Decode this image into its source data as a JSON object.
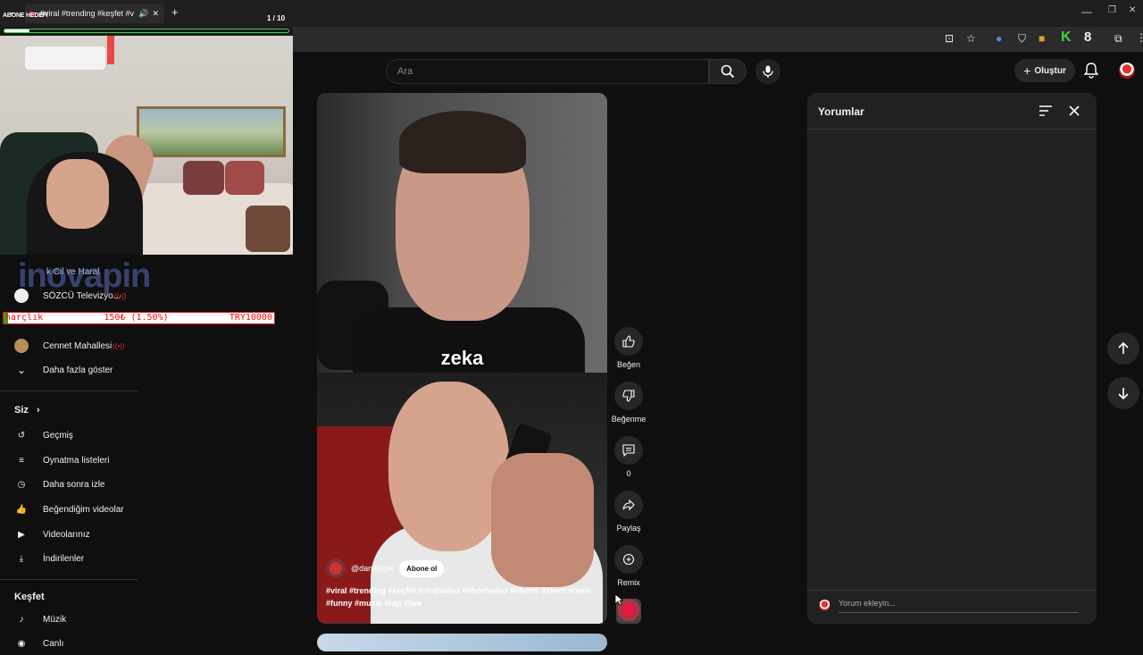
{
  "browser": {
    "tab_title": "#viral #trending #keşfet #v",
    "new_tab": "+",
    "minimize": "—",
    "restore": "❐",
    "close": "✕",
    "ext_badge": "8"
  },
  "header": {
    "search_placeholder": "Ara",
    "create_label": "Oluştur"
  },
  "overlay": {
    "goal_label": "ABONE HEDEFİ",
    "goal_count": "1 / 10",
    "tip_label": "harçlık",
    "tip_amount": "150₺ (1.50%)",
    "tip_target": "TRY10000",
    "tip_progress": 0.015,
    "sponsor": "inovapin"
  },
  "sidebar": {
    "subs": [
      {
        "label": "Cennet Mahallesi"
      },
      {
        "label": "Daha fazla göster"
      }
    ],
    "partial_items": [
      {
        "label": "k Cil ve Haral"
      },
      {
        "label": "SÖZCÜ Televizyo..."
      }
    ],
    "siz_label": "Siz",
    "siz_items": [
      {
        "label": "Geçmiş"
      },
      {
        "label": "Oynatma listeleri"
      },
      {
        "label": "Daha sonra izle"
      },
      {
        "label": "Beğendiğim videolar"
      },
      {
        "label": "Videolarınız"
      },
      {
        "label": "İndirilenler"
      }
    ],
    "explore_label": "Keşfet",
    "explore_items": [
      {
        "label": "Müzik"
      },
      {
        "label": "Canlı"
      }
    ]
  },
  "short": {
    "caption": "zeka",
    "channel": "@danidriple",
    "subscribe": "Abone ol",
    "description": "#viral #trending #keşfet #viralvideo #shortvideo #shorts #short #reels #funny #music #rap #live"
  },
  "actions": {
    "like": "Beğen",
    "dislike": "Beğenme",
    "comments_count": "0",
    "share": "Paylaş",
    "remix": "Remix"
  },
  "comments": {
    "title": "Yorumlar",
    "input_placeholder": "Yorum ekleyin..."
  },
  "colors": {
    "background": "#0f0f0f",
    "panel": "#212121",
    "live_red": "#e33333",
    "tip_green": "#29a329"
  }
}
